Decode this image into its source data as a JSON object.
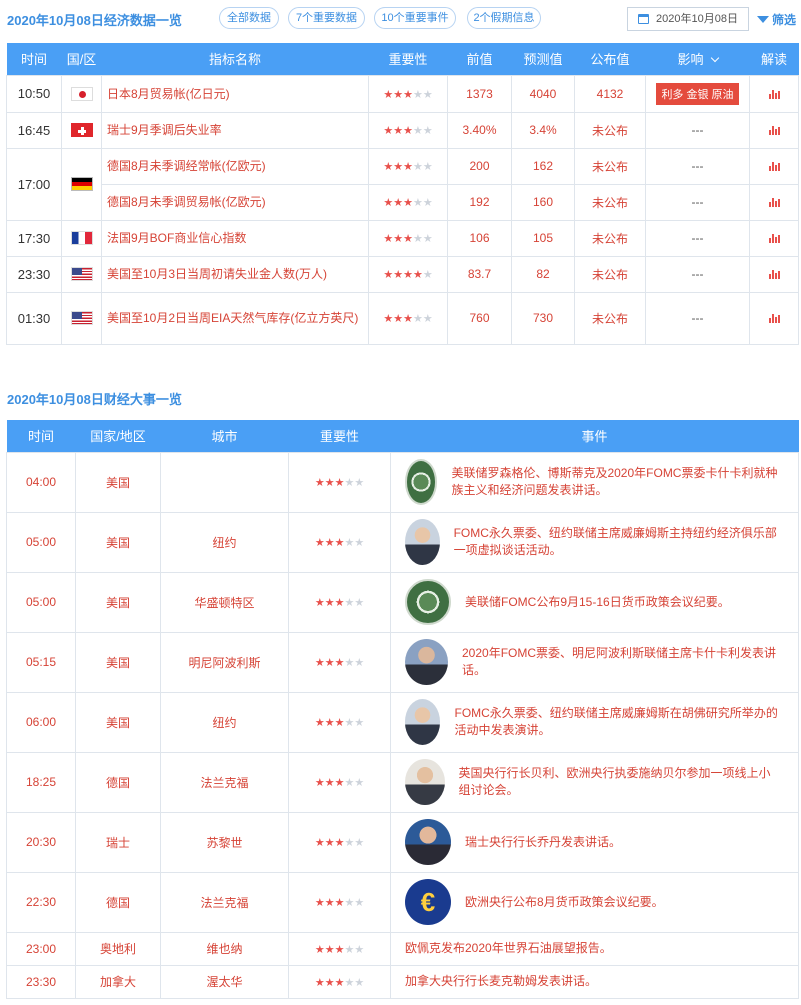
{
  "header": {
    "title": "2020年10月08日经济数据一览",
    "filters": [
      "全部数据",
      "7个重要数据",
      "10个重要事件",
      "2个假期信息"
    ],
    "date": "2020年10月08日",
    "filter_label": "筛选"
  },
  "econ_table": {
    "columns": [
      "时间",
      "国/区",
      "指标名称",
      "重要性",
      "前值",
      "预测值",
      "公布值",
      "影响",
      "解读"
    ],
    "rows": [
      {
        "time": "10:50",
        "flag": "jp",
        "name": "日本8月贸易帐(亿日元)",
        "stars": 3,
        "prev": "1373",
        "forecast": "4040",
        "actual": "4132",
        "impact": "利多 金银 原油"
      },
      {
        "time": "16:45",
        "flag": "ch",
        "name": "瑞士9月季调后失业率",
        "stars": 3,
        "prev": "3.40%",
        "forecast": "3.4%",
        "actual": "未公布",
        "impact": "---"
      },
      {
        "time": "17:00",
        "flag": "de",
        "name": "德国8月未季调经常帐(亿欧元)",
        "stars": 3,
        "prev": "200",
        "forecast": "162",
        "actual": "未公布",
        "impact": "---"
      },
      {
        "time": "",
        "flag": "",
        "name": "德国8月未季调贸易帐(亿欧元)",
        "stars": 3,
        "prev": "192",
        "forecast": "160",
        "actual": "未公布",
        "impact": "---"
      },
      {
        "time": "17:30",
        "flag": "fr",
        "name": "法国9月BOF商业信心指数",
        "stars": 3,
        "prev": "106",
        "forecast": "105",
        "actual": "未公布",
        "impact": "---"
      },
      {
        "time": "23:30",
        "flag": "us",
        "name": "美国至10月3日当周初请失业金人数(万人)",
        "stars": 4,
        "prev": "83.7",
        "forecast": "82",
        "actual": "未公布",
        "impact": "---"
      },
      {
        "time": "01:30",
        "flag": "us",
        "name": "美国至10月2日当周EIA天然气库存(亿立方英尺)",
        "stars": 3,
        "prev": "760",
        "forecast": "730",
        "actual": "未公布",
        "impact": "---"
      }
    ]
  },
  "events_title": "2020年10月08日财经大事一览",
  "events_table": {
    "columns": [
      "时间",
      "国家/地区",
      "城市",
      "重要性",
      "事件"
    ],
    "rows": [
      {
        "time": "04:00",
        "country": "美国",
        "city": "",
        "stars": 3,
        "avatar": "fed-seal",
        "text": "美联储罗森格伦、博斯蒂克及2020年FOMC票委卡什卡利就种族主义和经济问题发表讲话。"
      },
      {
        "time": "05:00",
        "country": "美国",
        "city": "纽约",
        "stars": 3,
        "avatar": "person",
        "text": "FOMC永久票委、纽约联储主席威廉姆斯主持纽约经济俱乐部一项虚拟谈话活动。"
      },
      {
        "time": "05:00",
        "country": "美国",
        "city": "华盛顿特区",
        "stars": 3,
        "avatar": "fed-seal",
        "text": "美联储FOMC公布9月15-16日货币政策会议纪要。"
      },
      {
        "time": "05:15",
        "country": "美国",
        "city": "明尼阿波利斯",
        "stars": 3,
        "avatar": "person2",
        "text": "2020年FOMC票委、明尼阿波利斯联储主席卡什卡利发表讲话。"
      },
      {
        "time": "06:00",
        "country": "美国",
        "city": "纽约",
        "stars": 3,
        "avatar": "person",
        "text": "FOMC永久票委、纽约联储主席威廉姆斯在胡佛研究所举办的活动中发表演讲。"
      },
      {
        "time": "18:25",
        "country": "德国",
        "city": "法兰克福",
        "stars": 3,
        "avatar": "person3",
        "text": "英国央行行长贝利、欧洲央行执委施纳贝尔参加一项线上小组讨论会。"
      },
      {
        "time": "20:30",
        "country": "瑞士",
        "city": "苏黎世",
        "stars": 3,
        "avatar": "person4",
        "text": "瑞士央行行长乔丹发表讲话。"
      },
      {
        "time": "22:30",
        "country": "德国",
        "city": "法兰克福",
        "stars": 3,
        "avatar": "ecb",
        "text": "欧洲央行公布8月货币政策会议纪要。"
      },
      {
        "time": "23:00",
        "country": "奥地利",
        "city": "维也纳",
        "stars": 3,
        "avatar": "",
        "text": "欧佩克发布2020年世界石油展望报告。"
      },
      {
        "time": "23:30",
        "country": "加拿大",
        "city": "渥太华",
        "stars": 3,
        "avatar": "",
        "text": "加拿大央行行长麦克勒姆发表讲话。"
      }
    ]
  },
  "colors": {
    "accent": "#4a9ff5",
    "title": "#3d8fe0",
    "red": "#d64336",
    "impact_bg": "#e44b3d"
  }
}
